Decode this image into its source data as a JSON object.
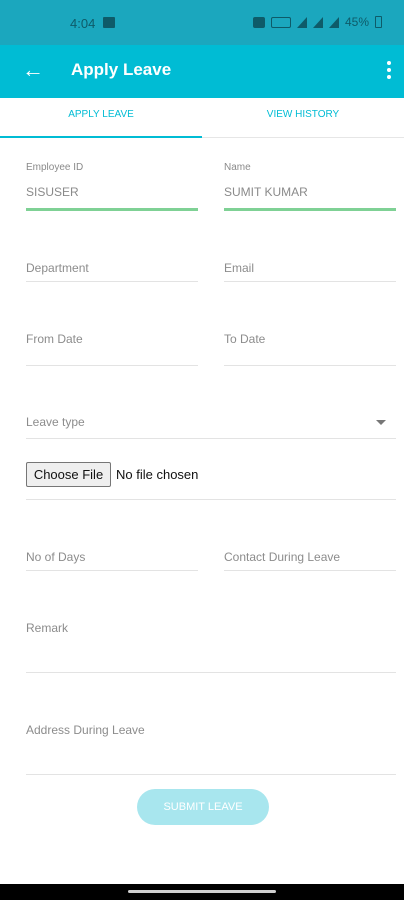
{
  "status_bar": {
    "time": "4:04",
    "battery": "45%",
    "icons": [
      "image-icon",
      "headphones-icon",
      "sim-icon",
      "wifi-icon",
      "signal-icon",
      "signal-icon",
      "battery-icon"
    ]
  },
  "app_bar": {
    "title": "Apply Leave",
    "back_icon": "arrow-left-icon",
    "menu_icon": "more-vertical-icon"
  },
  "tabs": {
    "apply_leave": "APPLY LEAVE",
    "view_history": "VIEW HISTORY",
    "active": "apply_leave"
  },
  "form": {
    "employee_id": {
      "label": "Employee ID",
      "value": "SISUSER"
    },
    "name": {
      "label": "Name",
      "value": "SUMIT KUMAR"
    },
    "department": {
      "placeholder": "Department"
    },
    "email": {
      "placeholder": "Email"
    },
    "from_date": {
      "placeholder": "From Date"
    },
    "to_date": {
      "placeholder": "To Date"
    },
    "leave_type": {
      "placeholder": "Leave type"
    },
    "file": {
      "button_label": "Choose File",
      "status": "No file chosen"
    },
    "no_of_days": {
      "placeholder": "No of Days"
    },
    "contact_during_leave": {
      "placeholder": "Contact During Leave"
    },
    "remark": {
      "placeholder": "Remark"
    },
    "address_during_leave": {
      "placeholder": "Address During Leave"
    }
  },
  "submit": {
    "label": "SUBMIT LEAVE"
  },
  "colors": {
    "primary": "#00bcd4",
    "status_bar": "#1ba7be",
    "valid_underline": "#7fd195",
    "submit_disabled": "#a8e6ee"
  }
}
